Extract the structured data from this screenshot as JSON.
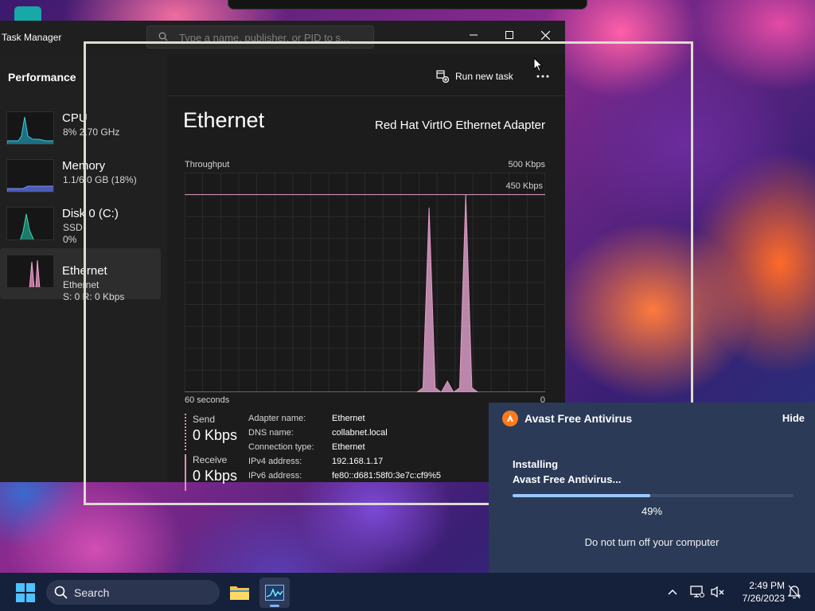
{
  "task_manager": {
    "title": "Task Manager",
    "search_placeholder": "Type a name, publisher, or PID to s...",
    "sidebar_heading": "Performance",
    "run_new_task_label": "Run new task",
    "sidebar": [
      {
        "name": "CPU",
        "sub1": "8%  2.70 GHz",
        "sub2": ""
      },
      {
        "name": "Memory",
        "sub1": "1.1/6.0 GB (18%)",
        "sub2": ""
      },
      {
        "name": "Disk 0 (C:)",
        "sub1": "SSD",
        "sub2": "0%"
      },
      {
        "name": "Ethernet",
        "sub1": "Ethernet",
        "sub2": "S: 0  R: 0 Kbps"
      }
    ],
    "detail": {
      "title": "Ethernet",
      "adapter": "Red Hat VirtIO Ethernet Adapter",
      "throughput_label": "Throughput",
      "max_label": "500 Kbps",
      "line_label": "450 Kbps",
      "time_label": "60 seconds",
      "zero_label": "0",
      "send_label": "Send",
      "send_value": "0 Kbps",
      "receive_label": "Receive",
      "receive_value": "0 Kbps",
      "info": [
        {
          "key": "Adapter name:",
          "value": "Ethernet"
        },
        {
          "key": "DNS name:",
          "value": "collabnet.local"
        },
        {
          "key": "Connection type:",
          "value": "Ethernet"
        },
        {
          "key": "IPv4 address:",
          "value": "192.168.1.17"
        },
        {
          "key": "IPv6 address:",
          "value": "fe80::d681:58f0:3e7c:cf9%5"
        }
      ]
    }
  },
  "chart_data": {
    "type": "area",
    "ylim": [
      0,
      500
    ],
    "reference_line": 450,
    "series": [
      {
        "values": [
          0,
          0,
          0,
          0,
          0,
          0,
          0,
          0,
          0,
          0,
          0,
          0,
          0,
          0,
          0,
          0,
          0,
          0,
          0,
          0,
          0,
          0,
          0,
          0,
          0,
          0,
          0,
          0,
          0,
          0,
          0,
          0,
          0,
          0,
          0,
          0,
          0,
          0,
          0,
          10,
          420,
          10,
          0,
          25,
          0,
          10,
          450,
          10,
          0,
          0,
          0,
          0,
          0,
          0,
          0,
          0,
          0,
          0,
          0,
          0
        ]
      }
    ]
  },
  "notification": {
    "app": "Avast Free Antivirus",
    "hide_label": "Hide",
    "status_line1": "Installing",
    "status_line2": "Avast Free Antivirus...",
    "progress": 0.49,
    "progress_text": "49%",
    "warning": "Do not turn off your computer"
  },
  "taskbar": {
    "search_label": "Search",
    "time": "2:49 PM",
    "date": "7/26/2023"
  },
  "colors": {
    "graph_line": "#e39ac6",
    "graph_fill": "#d79bc4",
    "avast_orange": "#ff7a1a"
  }
}
